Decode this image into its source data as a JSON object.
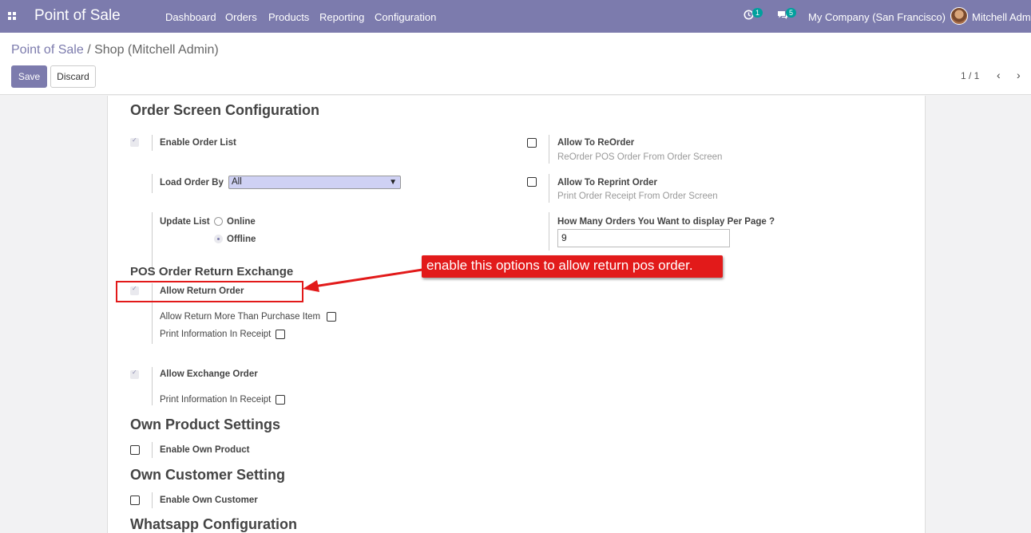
{
  "navbar": {
    "brand": "Point of Sale",
    "menu": [
      "Dashboard",
      "Orders",
      "Products",
      "Reporting",
      "Configuration"
    ],
    "activity_badge": "1",
    "messages_badge": "5",
    "company": "My Company (San Francisco)",
    "user": "Mitchell Admin"
  },
  "breadcrumb": {
    "parent": "Point of Sale",
    "separator": "/",
    "current": "Shop (Mitchell Admin)"
  },
  "buttons": {
    "save": "Save",
    "discard": "Discard"
  },
  "pager": {
    "value": "1 / 1",
    "prev": "‹",
    "next": "›"
  },
  "order_screen": {
    "title": "Order Screen Configuration",
    "enable_order_list": {
      "label": "Enable Order List",
      "checked": true
    },
    "allow_reorder": {
      "label": "Allow To ReOrder",
      "hint": "ReOrder POS Order From Order Screen",
      "checked": false
    },
    "load_order_by": {
      "label": "Load Order By",
      "value": "All"
    },
    "allow_reprint": {
      "label": "Allow To Reprint Order",
      "hint": "Print Order Receipt From Order Screen",
      "checked": false
    },
    "update_list": {
      "label": "Update List",
      "options": [
        "Online",
        "Offline"
      ],
      "selected": "Offline"
    },
    "orders_per_page": {
      "label": "How Many Orders You Want to display Per Page ?",
      "value": "9"
    }
  },
  "return_exchange": {
    "title": "POS Order Return Exchange",
    "allow_return": {
      "label": "Allow Return Order",
      "checked": true
    },
    "return_more": {
      "label": "Allow Return More Than Purchase Item",
      "checked": false
    },
    "return_print": {
      "label": "Print Information In Receipt",
      "checked": false
    },
    "allow_exchange": {
      "label": "Allow Exchange Order",
      "checked": true
    },
    "exchange_print": {
      "label": "Print Information In Receipt",
      "checked": false
    }
  },
  "own_product": {
    "title": "Own Product Settings",
    "label": "Enable Own Product",
    "checked": false
  },
  "own_customer": {
    "title": "Own Customer Setting",
    "label": "Enable Own Customer",
    "checked": false
  },
  "whatsapp": {
    "title": "Whatsapp Configuration"
  },
  "annotation": {
    "text": "enable this options to allow return pos order."
  },
  "colors": {
    "navbar": "#7c7bad",
    "accent": "#7c7bad",
    "annotation": "#e21a1a",
    "badge": "#00a09d"
  }
}
